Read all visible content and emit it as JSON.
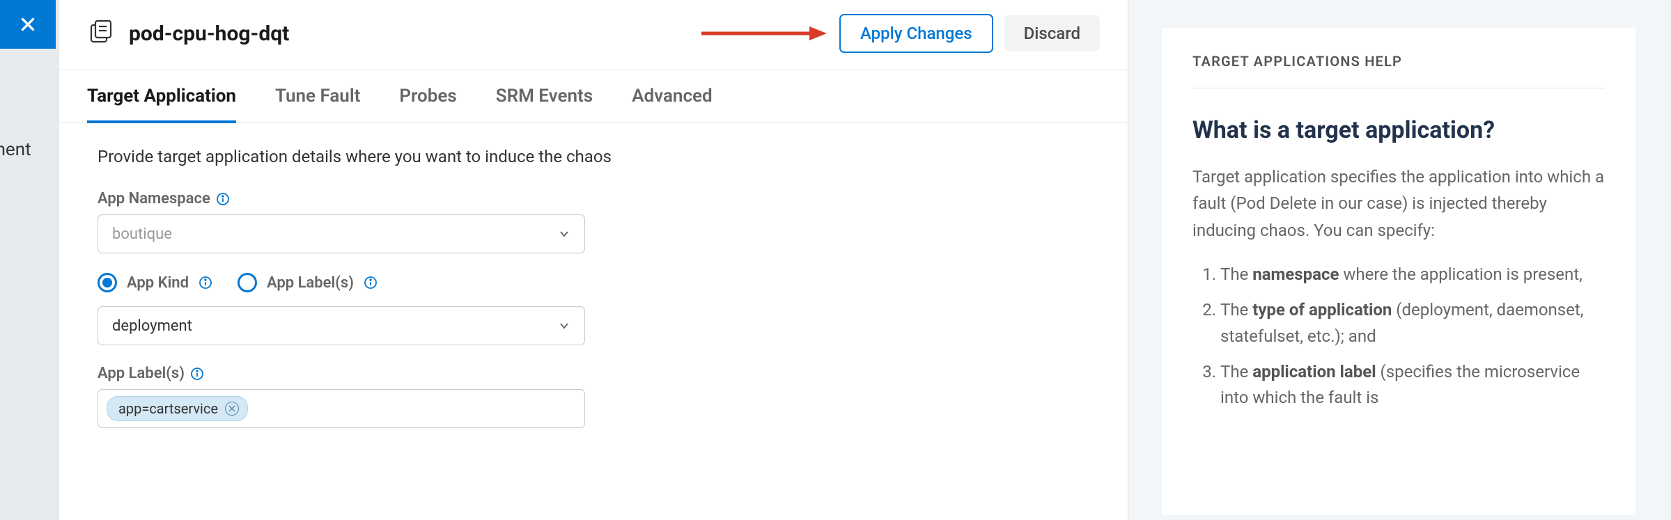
{
  "backdrop": {
    "truncated_text": "riment"
  },
  "header": {
    "title": "pod-cpu-hog-dqt",
    "apply_label": "Apply Changes",
    "discard_label": "Discard"
  },
  "tabs": [
    {
      "id": "target-application",
      "label": "Target Application",
      "active": true
    },
    {
      "id": "tune-fault",
      "label": "Tune Fault",
      "active": false
    },
    {
      "id": "probes",
      "label": "Probes",
      "active": false
    },
    {
      "id": "srm-events",
      "label": "SRM Events",
      "active": false
    },
    {
      "id": "advanced",
      "label": "Advanced",
      "active": false
    }
  ],
  "form": {
    "description": "Provide target application details where you want to induce the chaos",
    "app_namespace": {
      "label": "App Namespace",
      "value": "boutique",
      "placeholder_style": true
    },
    "radio": {
      "selected": "app-kind",
      "app_kind_label": "App Kind",
      "app_labels_label": "App Label(s)"
    },
    "app_kind": {
      "value": "deployment"
    },
    "app_labels": {
      "label": "App Label(s)",
      "tags": [
        "app=cartservice"
      ]
    }
  },
  "help": {
    "header": "TARGET APPLICATIONS HELP",
    "title": "What is a target application?",
    "body": "Target application specifies the application into which a fault (Pod Delete in our case) is injected thereby inducing chaos. You can specify:",
    "items": [
      {
        "prefix": "The ",
        "bold": "namespace",
        "suffix": " where the application is present,"
      },
      {
        "prefix": "The ",
        "bold": "type of application",
        "suffix": " (deployment, daemonset, statefulset, etc.); and"
      },
      {
        "prefix": "The ",
        "bold": "application label",
        "suffix": " (specifies the microservice into which the fault is"
      }
    ]
  }
}
